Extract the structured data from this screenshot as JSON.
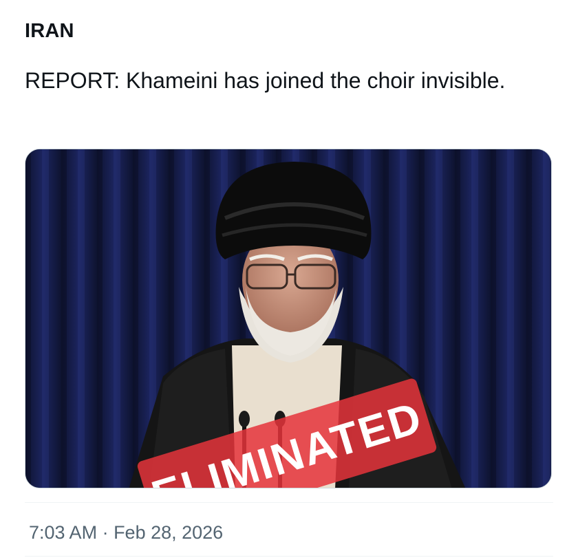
{
  "post": {
    "author_name": "IRAN",
    "text": "REPORT: Khameini has joined the choir invisible.",
    "media": {
      "stamp_text": "ELIMINATED",
      "stamp_color": "#e5343b"
    },
    "time": "7:03 AM",
    "separator": " · ",
    "date": "Feb 28, 2026"
  }
}
